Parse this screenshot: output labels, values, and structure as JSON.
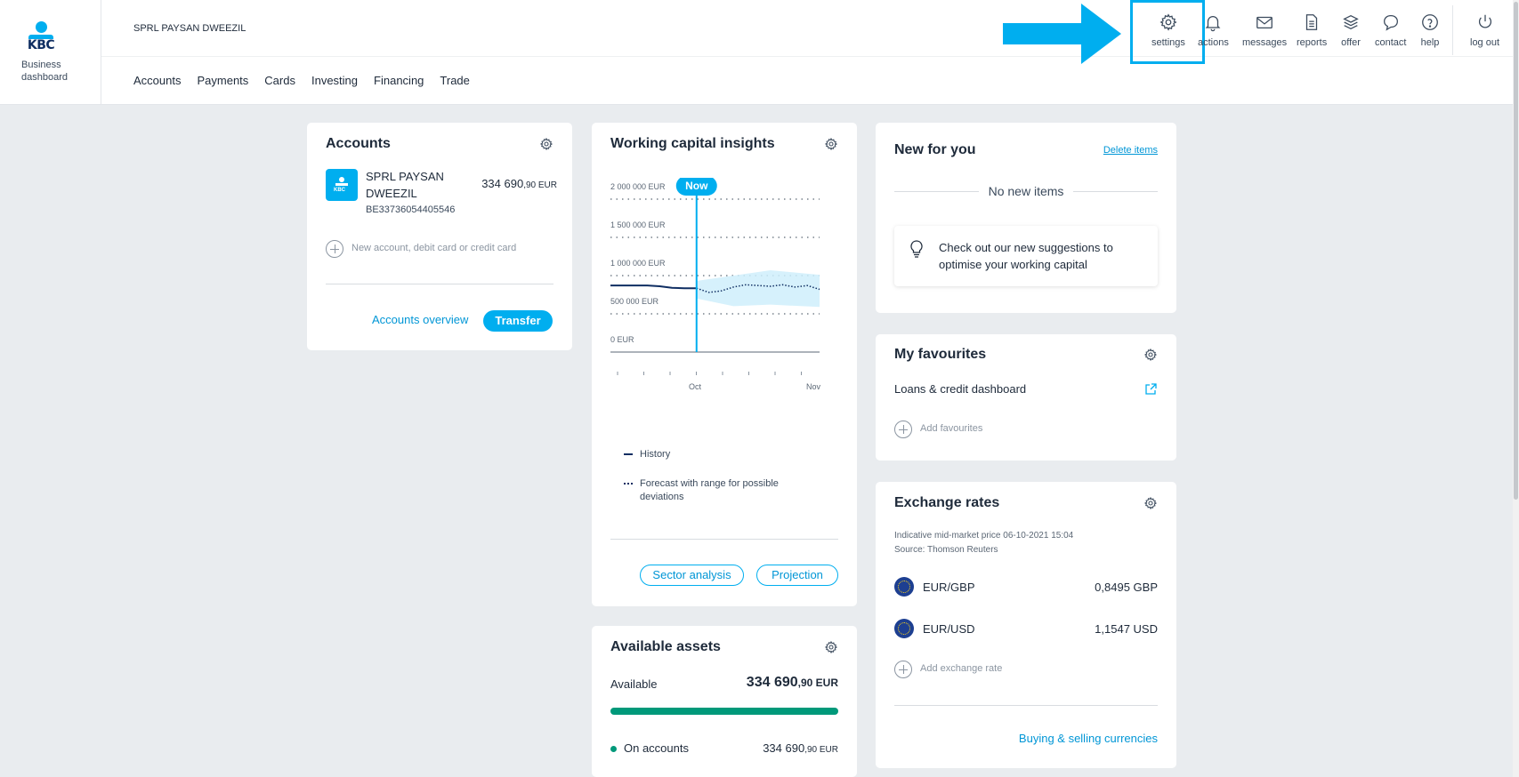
{
  "brand": {
    "logo_text": "KBC",
    "caption": "Business\ndashboard"
  },
  "header": {
    "company": "SPRL PAYSAN DWEEZIL",
    "nav": [
      "Accounts",
      "Payments",
      "Cards",
      "Investing",
      "Financing",
      "Trade"
    ],
    "utilities": [
      {
        "icon": "gear-icon",
        "label": "settings"
      },
      {
        "icon": "bell-icon",
        "label": "actions"
      },
      {
        "icon": "envelope-icon",
        "label": "messages"
      },
      {
        "icon": "document-icon",
        "label": "reports"
      },
      {
        "icon": "layers-icon",
        "label": "offer"
      },
      {
        "icon": "speech-bubble-icon",
        "label": "contact"
      },
      {
        "icon": "question-icon",
        "label": "help"
      },
      {
        "icon": "power-icon",
        "label": "log out"
      }
    ]
  },
  "accounts": {
    "title": "Accounts",
    "account_name_line1": "SPRL PAYSAN",
    "account_name_line2": "DWEEZIL",
    "iban": "BE33736054405546",
    "amount_main": "334 690",
    "amount_decimals": ",90 EUR",
    "add_label": "New account, debit card or credit card",
    "overview_link": "Accounts overview",
    "transfer_button": "Transfer"
  },
  "working_capital": {
    "title": "Working capital insights",
    "now_label": "Now",
    "legend_history": "History",
    "legend_forecast_line1": "Forecast with range for possible",
    "legend_forecast_line2": "deviations",
    "sector_button": "Sector analysis",
    "projection_button": "Projection"
  },
  "available_assets": {
    "title": "Available assets",
    "available_label": "Available",
    "available_main": "334 690",
    "available_decimals": ",90 EUR",
    "available_fraction": 1.0,
    "on_accounts_label": "On accounts",
    "on_accounts_main": "334 690",
    "on_accounts_decimals": ",90 EUR"
  },
  "new_for_you": {
    "title": "New for you",
    "delete_link": "Delete items",
    "empty_text": "No new items",
    "suggestion_line1": "Check out our new suggestions to",
    "suggestion_line2": "optimise your working capital"
  },
  "favourites": {
    "title": "My favourites",
    "item": "Loans & credit dashboard",
    "add_label": "Add favourites"
  },
  "exchange": {
    "title": "Exchange rates",
    "note_line1": "Indicative mid-market price 06-10-2021 15:04",
    "note_line2": "Source: Thomson Reuters",
    "rates": [
      {
        "pair": "EUR/GBP",
        "value": "0,8495 GBP"
      },
      {
        "pair": "EUR/USD",
        "value": "1,1547 USD"
      }
    ],
    "add_label": "Add exchange rate",
    "buy_sell_link": "Buying & selling currencies"
  },
  "colors": {
    "accent": "#00aeef",
    "navy": "#0f2e62",
    "assets_bar": "#00997a"
  },
  "chart_data": {
    "type": "line",
    "title": "",
    "xlabel": "",
    "ylabel": "",
    "y_ticks": [
      "2 000 000 EUR",
      "1 500 000 EUR",
      "1 000 000 EUR",
      "500 000 EUR",
      "0 EUR"
    ],
    "x_ticks": [
      "Oct",
      "Nov"
    ],
    "ylim": [
      0,
      2000000
    ],
    "now_marker": "Now",
    "series": [
      {
        "name": "History",
        "style": "solid",
        "color": "#0f2e62",
        "points": [
          [
            0,
            870000
          ],
          [
            1,
            870000
          ],
          [
            2,
            870000
          ],
          [
            3,
            870000
          ],
          [
            4,
            860000
          ],
          [
            5,
            840000
          ],
          [
            6,
            835000
          ],
          [
            7,
            835000
          ]
        ]
      },
      {
        "name": "Forecast with range for possible deviations",
        "style": "dotted",
        "color": "#0f2e62",
        "points": [
          [
            7,
            835000
          ],
          [
            8,
            780000
          ],
          [
            9,
            800000
          ],
          [
            10,
            850000
          ],
          [
            11,
            880000
          ],
          [
            12,
            870000
          ],
          [
            13,
            860000
          ],
          [
            14,
            880000
          ],
          [
            15,
            850000
          ],
          [
            16,
            870000
          ],
          [
            17,
            820000
          ]
        ],
        "range_low": [
          [
            7,
            700000
          ],
          [
            10,
            600000
          ],
          [
            13,
            620000
          ],
          [
            17,
            590000
          ]
        ],
        "range_high": [
          [
            7,
            930000
          ],
          [
            10,
            1000000
          ],
          [
            13,
            1070000
          ],
          [
            17,
            1010000
          ]
        ]
      }
    ],
    "x_domain": [
      0,
      17
    ],
    "now_x": 7
  }
}
